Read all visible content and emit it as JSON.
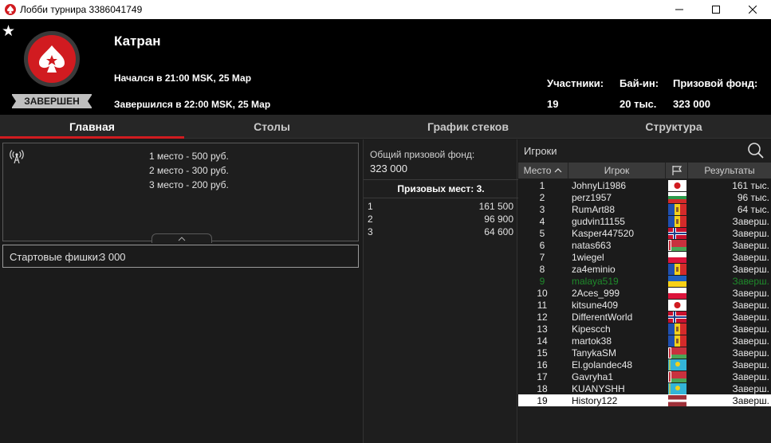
{
  "window": {
    "title": "Лобби турнира 3386041749"
  },
  "header": {
    "name": "Катран",
    "started": "Начался в 21:00 MSK, 25 Мар",
    "ended": "Завершился в 22:00 MSK, 25 Мар",
    "status": "ЗАВЕРШЕН",
    "participants_label": "Участники:",
    "participants_value": "19",
    "buyin_label": "Бай-ин:",
    "buyin_value": "20 тыс.",
    "prizepool_label": "Призовой фонд:",
    "prizepool_value": "323 000"
  },
  "tabs": [
    {
      "label": "Главная",
      "active": true
    },
    {
      "label": "Столы",
      "active": false
    },
    {
      "label": "График стеков",
      "active": false
    },
    {
      "label": "Структура",
      "active": false
    }
  ],
  "info": {
    "prize_lines": [
      "1 место - 500 руб.",
      "2 место - 300 руб.",
      "3 место - 200 руб."
    ],
    "starting_chips_label": "Стартовые фишки:",
    "starting_chips_value": "3 000"
  },
  "payouts": {
    "pool_label": "Общий призовой фонд:",
    "pool_value": "323 000",
    "paid_places": "Призовых мест: 3.",
    "rows": [
      {
        "place": "1",
        "amount": "161 500"
      },
      {
        "place": "2",
        "amount": "96 900"
      },
      {
        "place": "3",
        "amount": "64 600"
      }
    ]
  },
  "players": {
    "header": "Игроки",
    "columns": {
      "place": "Место",
      "player": "Игрок",
      "results": "Результаты"
    },
    "rows": [
      {
        "place": "1",
        "name": "JohnyLi1986",
        "flag": "japan",
        "result": "161 тыс."
      },
      {
        "place": "2",
        "name": "perz1957",
        "flag": "bulgaria",
        "result": "96 тыс."
      },
      {
        "place": "3",
        "name": "RumArt88",
        "flag": "moldova",
        "result": "64 тыс."
      },
      {
        "place": "4",
        "name": "gudvin11155",
        "flag": "moldova",
        "result": "Заверш."
      },
      {
        "place": "5",
        "name": "Kasper447520",
        "flag": "norway",
        "result": "Заверш."
      },
      {
        "place": "6",
        "name": "natas663",
        "flag": "belarus",
        "result": "Заверш."
      },
      {
        "place": "7",
        "name": "1wiegel",
        "flag": "poland",
        "result": "Заверш."
      },
      {
        "place": "8",
        "name": "za4eminio",
        "flag": "moldova",
        "result": "Заверш."
      },
      {
        "place": "9",
        "name": "malaya519",
        "flag": "ukraine",
        "result": "Заверш."
      },
      {
        "place": "10",
        "name": "2Aces_999",
        "flag": "poland",
        "result": "Заверш."
      },
      {
        "place": "11",
        "name": "kitsune409",
        "flag": "japan",
        "result": "Заверш."
      },
      {
        "place": "12",
        "name": "DifferentWorld",
        "flag": "norway",
        "result": "Заверш."
      },
      {
        "place": "13",
        "name": "Kipescch",
        "flag": "moldova",
        "result": "Заверш."
      },
      {
        "place": "14",
        "name": "martok38",
        "flag": "moldova",
        "result": "Заверш."
      },
      {
        "place": "15",
        "name": "TanykaSM",
        "flag": "belarus",
        "result": "Заверш."
      },
      {
        "place": "16",
        "name": "El.golandec48",
        "flag": "kazakhstan",
        "result": "Заверш."
      },
      {
        "place": "17",
        "name": "Gavryha1",
        "flag": "belarus",
        "result": "Заверш."
      },
      {
        "place": "18",
        "name": "KUANYSHH",
        "flag": "kazakhstan",
        "result": "Заверш."
      },
      {
        "place": "19",
        "name": "History122",
        "flag": "latvia",
        "result": "Заверш."
      }
    ]
  },
  "colors": {
    "accent": "#d11b20",
    "highlight_player": "#1f8a2b"
  }
}
